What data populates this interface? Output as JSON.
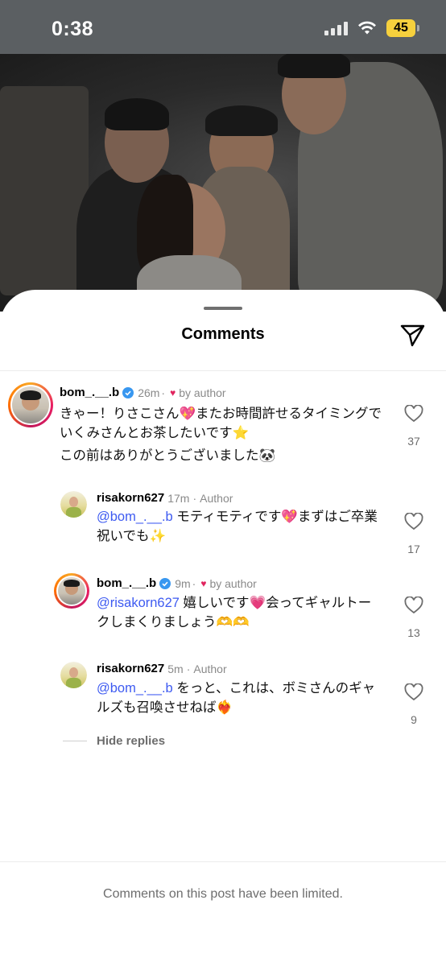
{
  "status_bar": {
    "time": "0:38",
    "battery": "45"
  },
  "sheet": {
    "title": "Comments"
  },
  "comments": [
    {
      "username": "bom_.__.b",
      "verified": true,
      "time": "26m",
      "tag": "by author",
      "text_line1": "きゃー！りさこさん💖またお時間許せるタイミングで",
      "text_line2": "いくみさんとお茶したいです⭐",
      "text_line3": "この前はありがとうございました🐼",
      "likes": "37"
    },
    {
      "username": "risakorn627",
      "time": "17m",
      "tag": "Author",
      "mention": "@bom_.__.b",
      "text_line1": " モティモティです💖まずはご卒業",
      "text_line2": "祝いでも✨",
      "likes": "17"
    },
    {
      "username": "bom_.__.b",
      "verified": true,
      "time": "9m",
      "tag": "by author",
      "mention": "@risakorn627",
      "text_line1": " 嬉しいです💗会ってギャルトー",
      "text_line2": "クしまくりましょう🫶🫶",
      "likes": "13"
    },
    {
      "username": "risakorn627",
      "time": "5m",
      "tag": "Author",
      "mention": "@bom_.__.b",
      "text_line1": " をっと、これは、ボミさんのギャ",
      "text_line2": "ルズも召喚させねば❤️‍🔥",
      "likes": "9"
    }
  ],
  "hide_replies": "Hide replies",
  "footer": {
    "limited_text": "Comments on this post have been limited."
  },
  "colors": {
    "mention": "#3d5af1",
    "heart": "#e0245e",
    "verified": "#3897f0",
    "battery": "#f6d03d"
  },
  "icons": [
    "signal-icon",
    "wifi-icon",
    "battery-icon",
    "send-icon",
    "verified-icon",
    "heart-outline-icon"
  ]
}
